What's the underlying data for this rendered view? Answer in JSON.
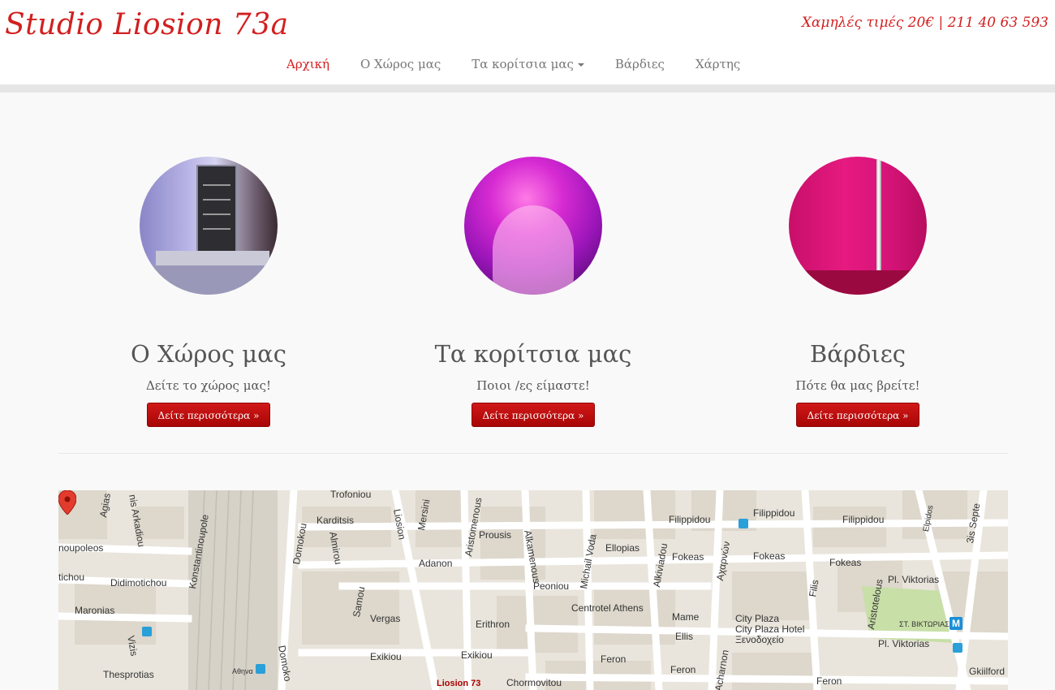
{
  "header": {
    "brand": "Studio Liosion 73a",
    "contact": "Χαμηλές τιμές 20€ | 211 40 63 593"
  },
  "nav": {
    "items": [
      {
        "label": "Αρχική"
      },
      {
        "label": "Ο Χώρος μας"
      },
      {
        "label": "Τα κορίτσια μας"
      },
      {
        "label": "Βάρδιες"
      },
      {
        "label": "Χάρτης"
      }
    ]
  },
  "features": [
    {
      "title": "Ο Χώρος μας",
      "text": "Δείτε το χώρος μας!",
      "button": "Δείτε περισσότερα »"
    },
    {
      "title": "Τα κορίτσια μας",
      "text": "Ποιοι /ες είμαστε!",
      "button": "Δείτε περισσότερα »"
    },
    {
      "title": "Βάρδιες",
      "text": "Πότε θα μας βρείτε!",
      "button": "Δείτε περισσότερα »"
    }
  ],
  "map": {
    "labels": {
      "agias": "Agias",
      "nis_arkadiou": "nis Arkadiou",
      "noupoleos": "noupoleos",
      "tichou": "tichou",
      "didimotichou": "Didimotichou",
      "maronias": "Maronias",
      "vizis": "Vizis",
      "thesprotias": "Thesprotias",
      "konstantinoupole": "Konstantinoupole",
      "domokou": "Domokou",
      "domoko": "Domoko",
      "karditsis": "Karditsis",
      "almirou": "Almirou",
      "samou": "Samou",
      "trofoniou": "Trofoniou",
      "liosion": "Liosion",
      "mersini": "Mersini",
      "adanon": "Adanon",
      "vergas": "Vergas",
      "exikiou_1": "Exikiou",
      "exikiou_2": "Exikiou",
      "aristomenous": "Aristomenous",
      "prousis": "Prousis",
      "alkamenous": "Alkamenous",
      "peoniou": "Peoniou",
      "erithron": "Erithron",
      "chormovitou": "Chormovitou",
      "michail_voda": "Michail Voda",
      "ellopias": "Ellopias",
      "centrotel": "Centrotel Athens",
      "feron_1": "Feron",
      "alkiviadou": "Alkiviadou",
      "filippidou_1": "Filippidou",
      "fokeas_1": "Fokeas",
      "mame": "Mame",
      "ellis": "Ellis",
      "feron_2": "Feron",
      "acharnon_gr": "Αχαρνών",
      "acharnon": "Acharnon",
      "city_plaza": "City Plaza",
      "city_plaza_hotel": "City Plaza Hotel",
      "xenodocheio": "Ξενοδοχείο",
      "filippidou_2": "Filippidou",
      "filippidou_3": "Filippidou",
      "fokeas_2": "Fokeas",
      "fokeas_3": "Fokeas",
      "filis": "Filis",
      "aristotelous": "Aristotelous",
      "pl_viktorias_1": "Pl. Viktorias",
      "pl_viktorias_2": "Pl. Viktorias",
      "st_viktorias": "ΣΤ. ΒΙΚΤΩΡΙΑΣ",
      "elpidos": "Elpidos",
      "sept": "3is Septe",
      "gkiilford": "Gkiilford",
      "feron_3": "Feron",
      "athina": "Αθηνα",
      "pin_label": "Liosion 73"
    },
    "metro_glyph": "M"
  }
}
